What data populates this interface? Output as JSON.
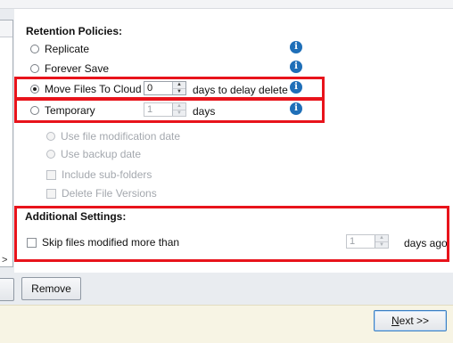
{
  "retention": {
    "title": "Retention Policies:",
    "options": [
      {
        "label": "Replicate",
        "checked": false
      },
      {
        "label": "Forever Save",
        "checked": false
      },
      {
        "label": "Move Files To Cloud",
        "checked": true,
        "spin_value": "0",
        "suffix": "days to delay delete"
      },
      {
        "label": "Temporary",
        "checked": false,
        "spin_value": "1",
        "suffix": "days"
      }
    ],
    "sub_options": [
      {
        "label": "Use file modification date",
        "kind": "radio"
      },
      {
        "label": "Use backup date",
        "kind": "radio"
      },
      {
        "label": "Include sub-folders",
        "kind": "checkbox"
      },
      {
        "label": "Delete File Versions",
        "kind": "checkbox"
      }
    ]
  },
  "additional": {
    "title": "Additional Settings:",
    "skip_label": "Skip files modified more than",
    "skip_value": "1",
    "skip_suffix": "days ago"
  },
  "buttons": {
    "remove": "Remove",
    "next_letter": "N",
    "next_rest": "ext >>"
  },
  "left_panel": {
    "chevron": ">"
  },
  "colors": {
    "highlight": "#e8131b",
    "info_icon": "#1f6fb8"
  },
  "icons": {
    "info": "info-icon",
    "spin_up": "spin-up-arrow",
    "spin_down": "spin-down-arrow"
  }
}
